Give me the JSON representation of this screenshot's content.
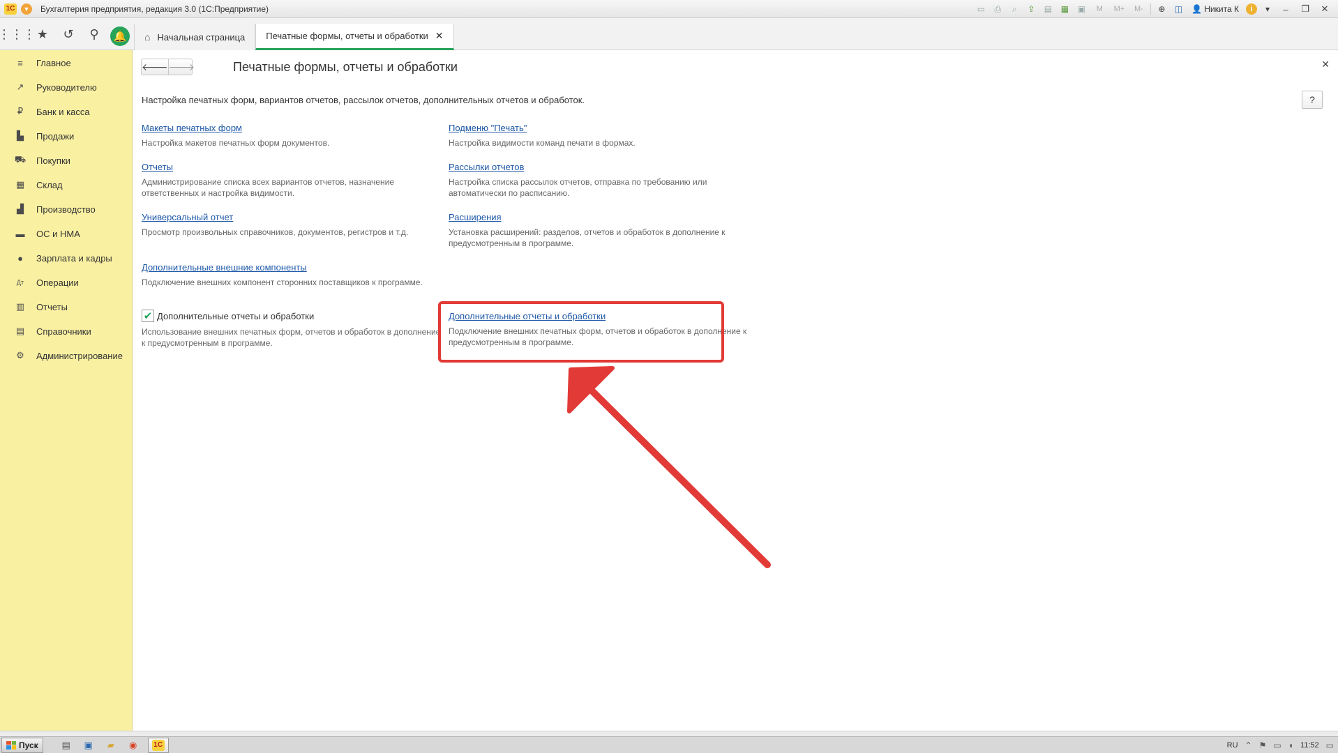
{
  "titlebar": {
    "logo_text": "1С",
    "title": "Бухгалтерия предприятия, редакция 3.0  (1С:Предприятие)",
    "user": "Никита К",
    "m_buttons": [
      "M",
      "M+",
      "M-"
    ]
  },
  "tabs": [
    {
      "label": "Начальная страница"
    },
    {
      "label": "Печатные формы, отчеты и обработки",
      "close": "✕"
    }
  ],
  "sidebar": {
    "items": [
      {
        "label": "Главное",
        "icon": "menu-icon"
      },
      {
        "label": "Руководителю",
        "icon": "trend-icon"
      },
      {
        "label": "Банк и касса",
        "icon": "ruble-icon"
      },
      {
        "label": "Продажи",
        "icon": "bag-icon"
      },
      {
        "label": "Покупки",
        "icon": "cart-icon"
      },
      {
        "label": "Склад",
        "icon": "grid-icon"
      },
      {
        "label": "Производство",
        "icon": "factory-icon"
      },
      {
        "label": "ОС и НМА",
        "icon": "truck-icon"
      },
      {
        "label": "Зарплата и кадры",
        "icon": "person-icon"
      },
      {
        "label": "Операции",
        "icon": "dt-kt-icon"
      },
      {
        "label": "Отчеты",
        "icon": "bar-chart-icon"
      },
      {
        "label": "Справочники",
        "icon": "book-icon"
      },
      {
        "label": "Администрирование",
        "icon": "gear-icon"
      }
    ]
  },
  "main": {
    "title": "Печатные формы, отчеты и обработки",
    "intro": "Настройка печатных форм, вариантов отчетов, рассылок отчетов, дополнительных отчетов и обработок.",
    "help": "?",
    "close": "✕",
    "left": [
      {
        "link": "Макеты печатных форм",
        "desc": "Настройка макетов печатных форм документов."
      },
      {
        "link": "Отчеты",
        "desc": "Администрирование списка всех вариантов отчетов, назначение ответственных и настройка видимости."
      },
      {
        "link": "Универсальный отчет",
        "desc": "Просмотр произвольных справочников, документов, регистров и т.д."
      },
      {
        "link": "Дополнительные внешние компоненты",
        "desc": "Подключение внешних компонент сторонних поставщиков к программе."
      }
    ],
    "checkbox": {
      "label": "Дополнительные отчеты и обработки",
      "checked": true,
      "desc": "Использование внешних печатных форм, отчетов и обработок в дополнение к предусмотренным в программе."
    },
    "right": [
      {
        "link": "Подменю \"Печать\"",
        "desc": "Настройка видимости команд печати в формах."
      },
      {
        "link": "Рассылки отчетов",
        "desc": "Настройка списка рассылок отчетов, отправка по требованию или автоматически по расписанию."
      },
      {
        "link": "Расширения",
        "desc": "Установка расширений: разделов, отчетов и обработок в дополнение к предусмотренным в программе."
      },
      {
        "link": "Дополнительные отчеты и обработки",
        "desc": "Подключение внешних печатных форм, отчетов и обработок в дополнение к предусмотренным в программе."
      }
    ],
    "highlight_color": "#e23a36"
  },
  "taskbar": {
    "start": "Пуск",
    "lang": "RU",
    "time": "11:52"
  }
}
